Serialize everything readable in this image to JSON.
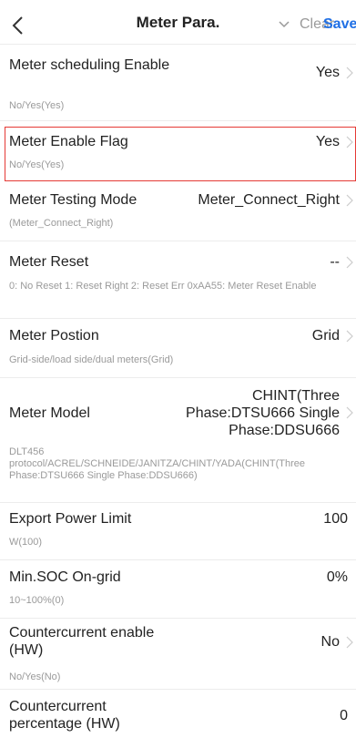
{
  "header": {
    "title": "Meter Para.",
    "clear_label": "Clear",
    "save_label": "Save",
    "icons": [
      "back-icon",
      "chevron-down-icon"
    ]
  },
  "colors": {
    "accent": "#1f6fe5",
    "highlight": "#e53935",
    "muted": "#9a9a9a"
  },
  "rows": [
    {
      "label": "Meter scheduling Enable",
      "value": "Yes",
      "hint": "No/Yes(Yes)"
    },
    {
      "label": "Meter Enable Flag",
      "value": "Yes",
      "hint": "No/Yes(Yes)"
    },
    {
      "label": "Meter Testing Mode",
      "value": "Meter_Connect_Right",
      "hint": "(Meter_Connect_Right)"
    },
    {
      "label": "Meter Reset",
      "value": "--",
      "hint": "0: No Reset 1: Reset Right 2: Reset Err 0xAA55: Meter Reset Enable"
    },
    {
      "label": "Meter Postion",
      "value": "Grid",
      "hint": "Grid-side/load side/dual meters(Grid)"
    },
    {
      "label": "Meter Model",
      "value": "CHINT(Three Phase:DTSU666 Single Phase:DDSU666",
      "hint": "DLT456 protocol/ACREL/SCHNEIDE/JANITZA/CHINT/YADA(CHINT(Three Phase:DTSU666 Single Phase:DDSU666)"
    },
    {
      "label": "Export Power Limit",
      "value": "100",
      "hint": "W(100)"
    },
    {
      "label": "Min.SOC On-grid",
      "value": "0%",
      "hint": "10~100%(0)"
    },
    {
      "label": "Countercurrent enable (HW)",
      "value": "No",
      "hint": "No/Yes(No)"
    },
    {
      "label": "Countercurrent percentage (HW)",
      "value": "0",
      "hint": ""
    }
  ]
}
